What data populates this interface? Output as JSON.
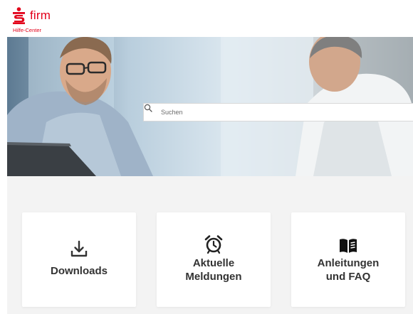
{
  "brand": {
    "name": "firm",
    "subtitle": "Hilfe-Center",
    "color": "#e2001a"
  },
  "search": {
    "placeholder": "Suchen",
    "icon": "search-icon"
  },
  "tiles": [
    {
      "line1": "Downloads",
      "line2": "",
      "icon": "download-icon"
    },
    {
      "line1": "Aktuelle",
      "line2": "Meldungen",
      "icon": "alarm-clock-icon"
    },
    {
      "line1": "Anleitungen",
      "line2": "und FAQ",
      "icon": "book-icon"
    }
  ]
}
